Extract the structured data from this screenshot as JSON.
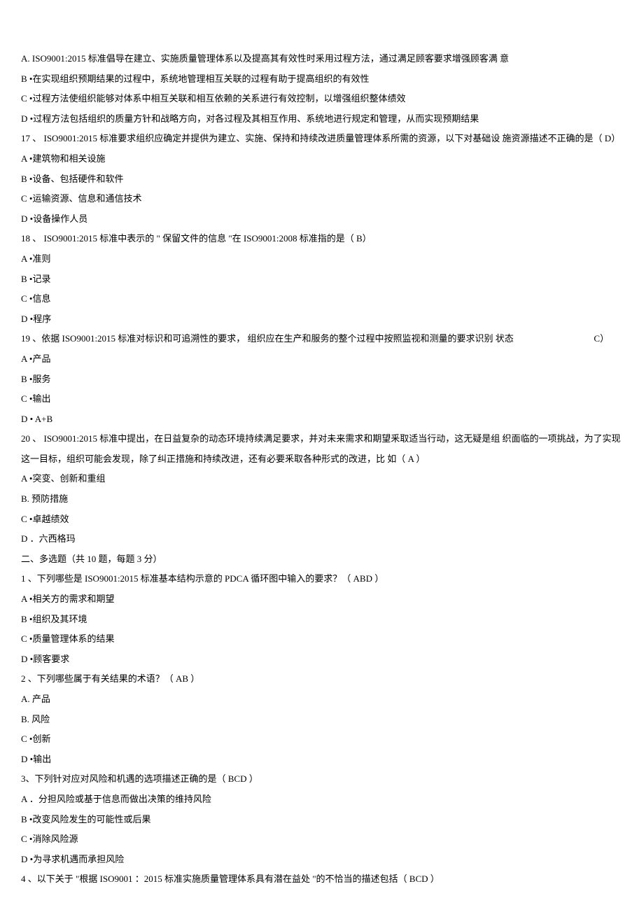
{
  "lines": {
    "l1": "A. ISO9001:2015 标准倡导在建立、实施质量管理体系以及提高其有效性时釆用过程方法，通过满足顾客要求增强顾客满 意",
    "l2": "B •在实现组织预期结果的过程中，系统地管理相互关联的过程有助于提高组织的有效性",
    "l3": "C •过程方法使组织能够对体系中相互关联和相互依赖的关系进行有效控制，以增强组织整体绩效",
    "l4": "D •过程方法包括组织的质量方针和战略方向，对各过程及其相互作用、系统地进行规定和管理，从而实现预期结果",
    "l5": "17 、 ISO9001:2015 标准要求组织应确定并提供为建立、实施、保持和持续改进质量管理体系所需的资源，以下对基础设 施资源描述不正确的是（ D）",
    "l6": "A •建筑物和相关设施",
    "l7": "B •设备、包括硬件和软件",
    "l8": "C •运输资源、信息和通信技术",
    "l9": "D •设备操作人员",
    "l10": "18 、 ISO9001:2015 标准中表示的 \" 保留文件的信息 \"在 ISO9001:2008 标准指的是（ B）",
    "l11": "A •准则",
    "l12": "B •记录",
    "l13": "C •信息",
    "l14": "D •程序",
    "l15_left": "19 、依据 ISO9001:2015 标准对标识和可追溯性的要求， 组织应在生产和服务的整个过程中按照监视和测量的要求识别 状态",
    "l15_right": "C）",
    "l16": "A •产品",
    "l17": "B •服务",
    "l18": "C •输出",
    "l19": "D • A+B",
    "l20": "20 、 ISO9001:2015 标准中提出，在日益复杂的动态环境持续满足要求，并对未来需求和期望釆取适当行动，这无疑是组 织面临的一项挑战，为了实现这一目标，组织可能会发现，除了纠正措施和持续改进，还有必要釆取各种形式的改进，比 如（ A ）",
    "l21": "A •突变、创新和重组",
    "l22": "B. 预防措施",
    "l23": "C •卓越绩效",
    "l24": "D ．六西格玛",
    "l25": "二、多选题（共 10 题，每题 3 分）",
    "l26": "1 、下列哪些是 ISO9001:2015 标准基本结构示意的 PDCA 循环图中输入的要求？（ ABD ）",
    "l27": "A •相关方的需求和期望",
    "l28": "B •组织及其环境",
    "l29": "C •质量管理体系的结果",
    "l30": "D •顾客要求",
    "l31": "2 、下列哪些属于有关结果的术语？（  AB ）",
    "l32": "A. 产品",
    "l33": "B. 风险",
    "l34": "C •创新",
    "l35": "D •输出",
    "l36": "3、下列针对应对风险和机遇的选项描述正确的是（    BCD ）",
    "l37": "A ．分担风险或基于信息而做出决策的维持风险",
    "l38": "B •改变风险发生的可能性或后果",
    "l39": "C •消除风险源",
    "l40": "D •为寻求机遇而承担风险",
    "l41": "4 、以下关于 \"根据 ISO9001 ：2015 标准实施质量管理体系具有潜在益处 \"的不恰当的描述包括（ BCD ）"
  }
}
